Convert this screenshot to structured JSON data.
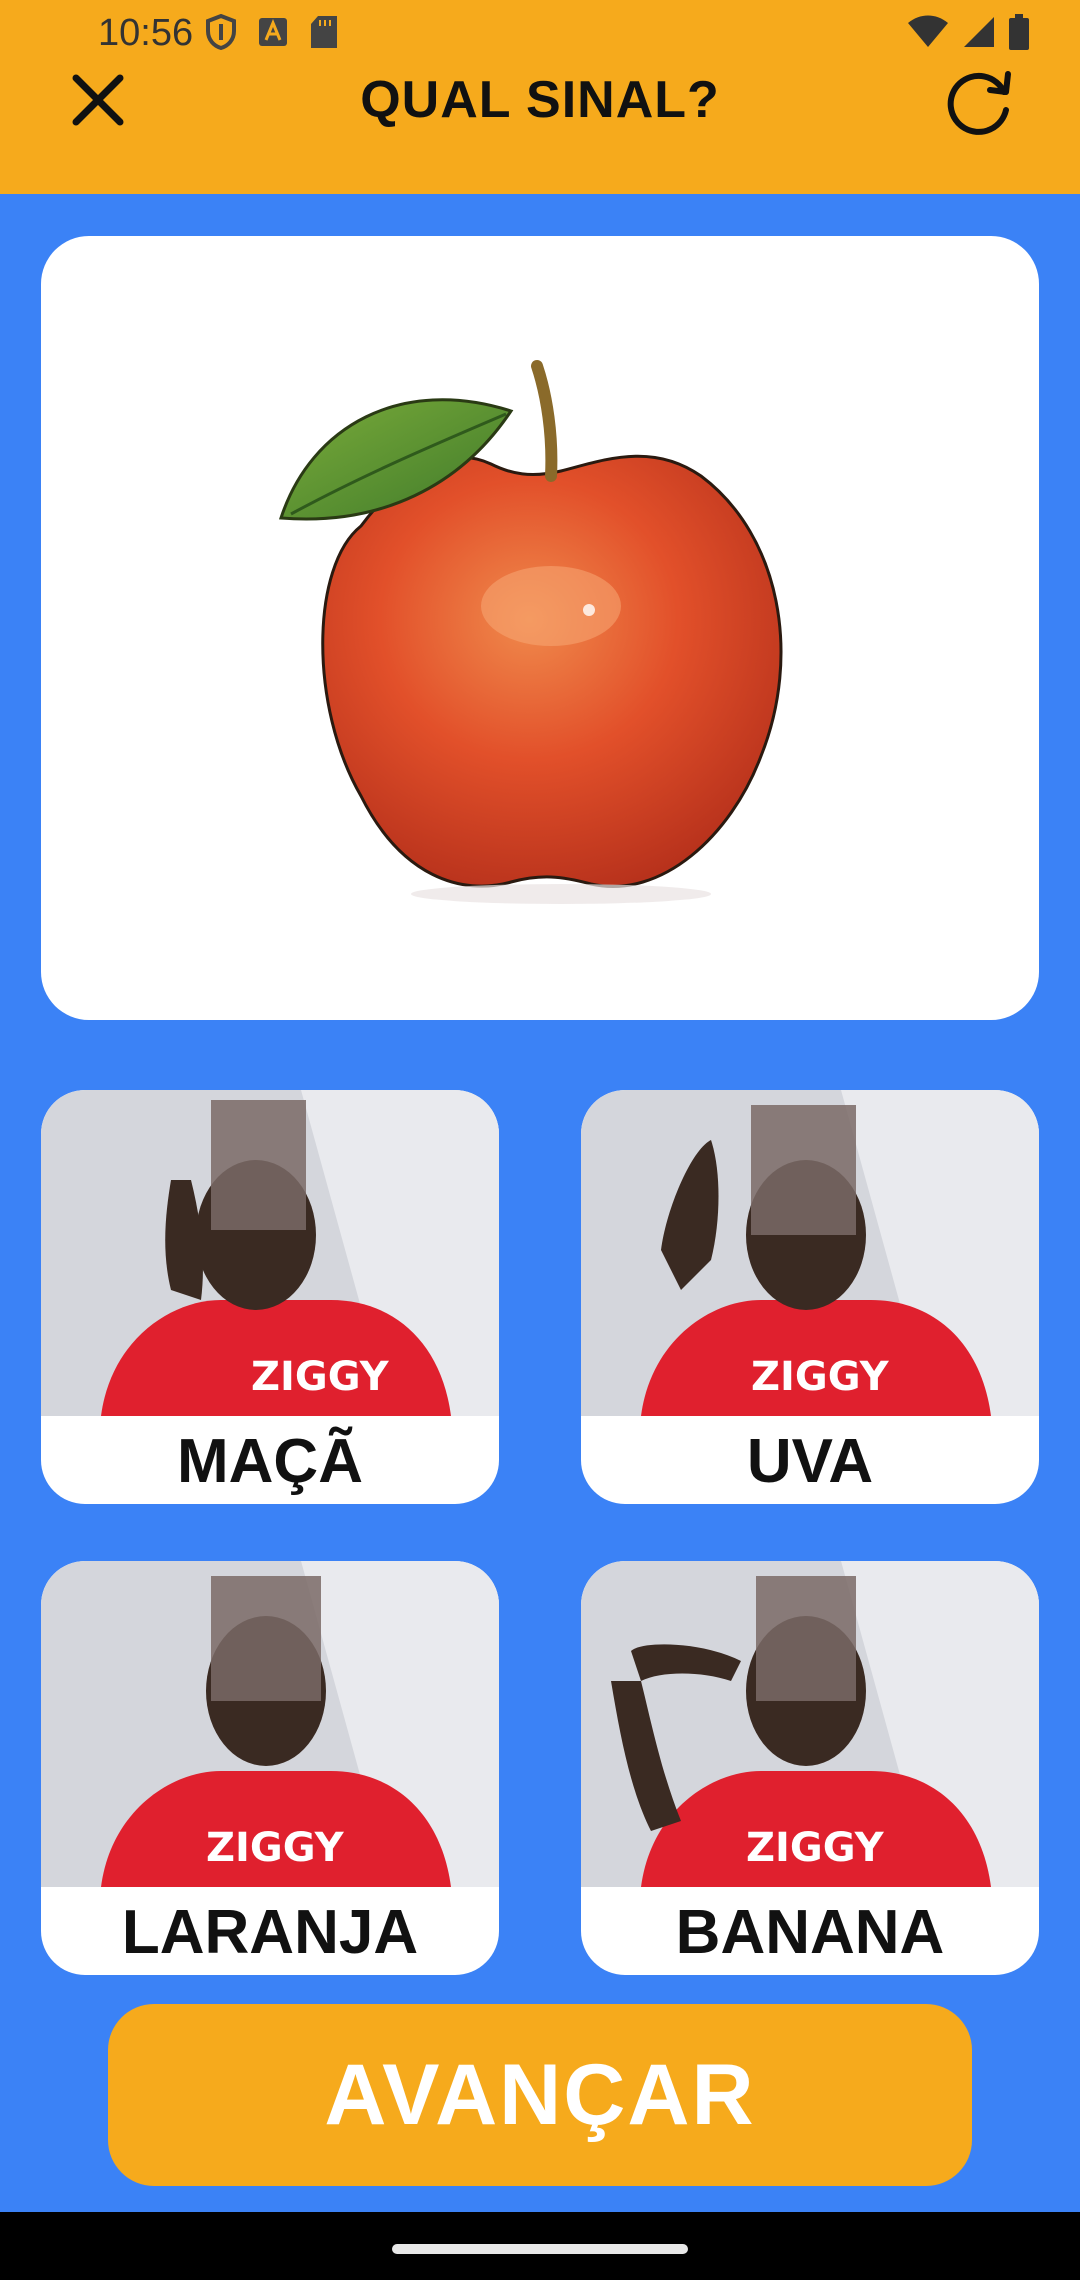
{
  "status_bar": {
    "time": "10:56",
    "left_icons": [
      "shield-icon",
      "a-badge-icon",
      "sd-card-icon"
    ],
    "right_icons": [
      "wifi-icon",
      "signal-icon",
      "battery-icon"
    ]
  },
  "header": {
    "title": "QUAL SINAL?",
    "close_icon": "close-icon",
    "refresh_icon": "refresh-icon",
    "background_color": "#f6aa1c"
  },
  "prompt_image": {
    "subject": "apple-illustration"
  },
  "options": [
    {
      "label": "MAÇÃ"
    },
    {
      "label": "UVA"
    },
    {
      "label": "LARANJA"
    },
    {
      "label": "BANANA"
    }
  ],
  "footer": {
    "advance_label": "AVANÇAR"
  },
  "colors": {
    "background": "#3b82f6",
    "accent": "#f6aa1c"
  }
}
